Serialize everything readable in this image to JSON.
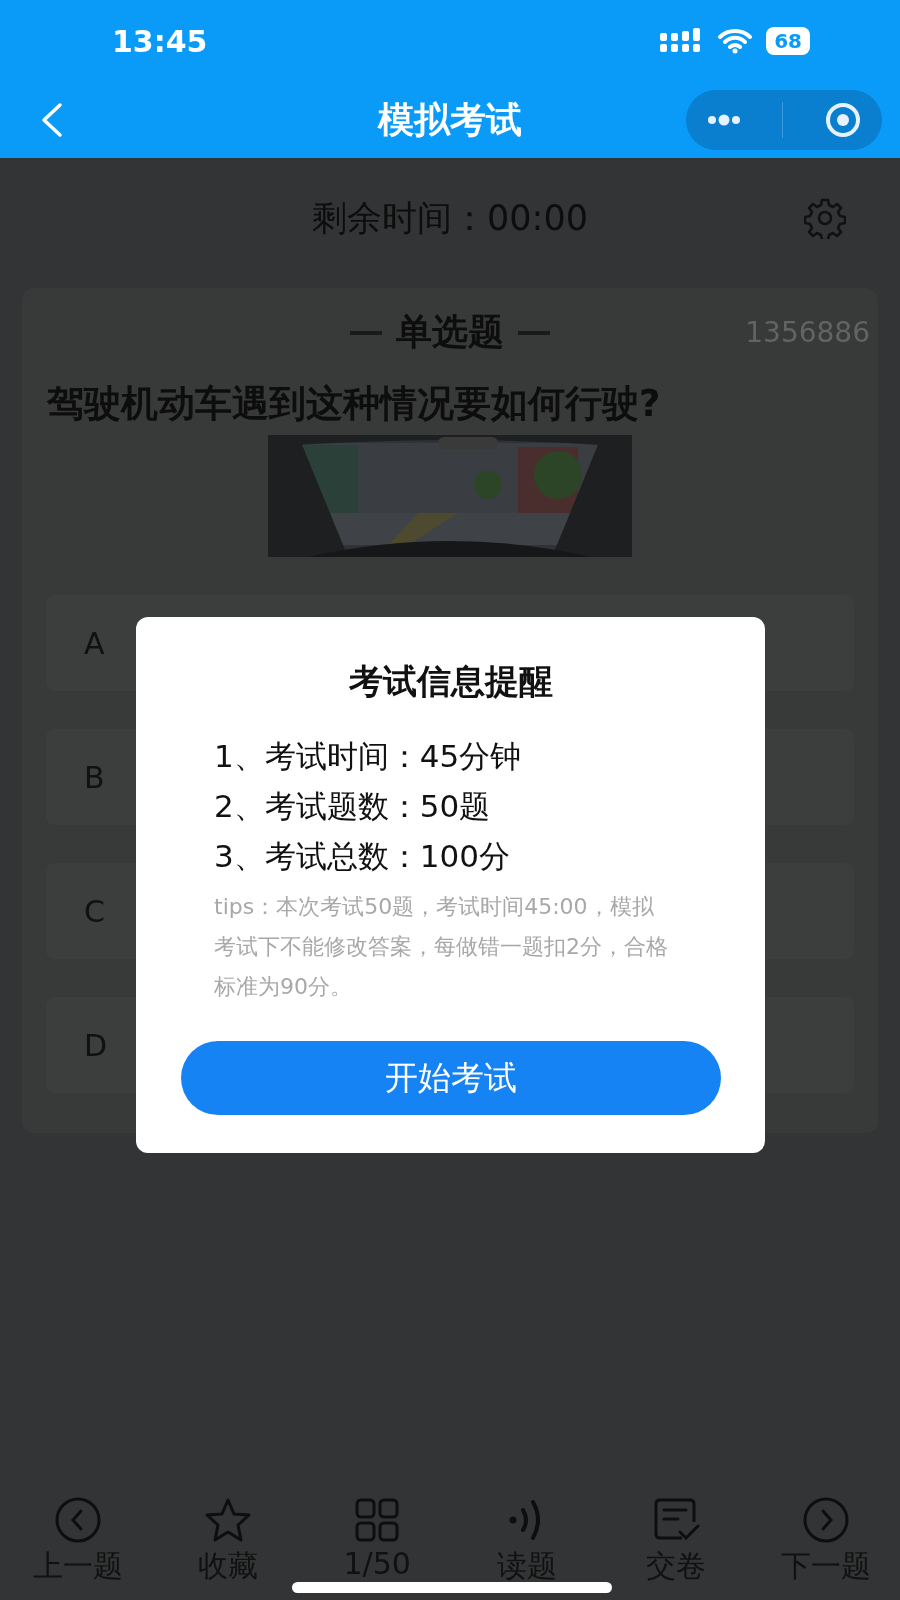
{
  "status_bar": {
    "time": "13:45",
    "battery": "68"
  },
  "nav": {
    "title": "模拟考试"
  },
  "timer": {
    "label": "剩余时间：",
    "value": "00:00"
  },
  "question": {
    "type": "单选题",
    "id": "1356886",
    "text": "驾驶机动车遇到这种情况要如何行驶?"
  },
  "options": [
    {
      "letter": "A"
    },
    {
      "letter": "B"
    },
    {
      "letter": "C"
    },
    {
      "letter": "D"
    }
  ],
  "dialog": {
    "title": "考试信息提醒",
    "items": [
      "1、考试时间：45分钟",
      "2、考试题数：50题",
      "3、考试总数：100分"
    ],
    "tips": "tips：本次考试50题，考试时间45:00，模拟考试下不能修改答案，每做错一题扣2分，合格标准为90分。",
    "button": "开始考试"
  },
  "toolbar": [
    {
      "kind": "prev",
      "label": "上一题"
    },
    {
      "kind": "star",
      "label": "收藏"
    },
    {
      "kind": "grid",
      "label": "1/50"
    },
    {
      "kind": "audio",
      "label": "读题"
    },
    {
      "kind": "submit",
      "label": "交卷"
    },
    {
      "kind": "next",
      "label": "下一题"
    }
  ]
}
